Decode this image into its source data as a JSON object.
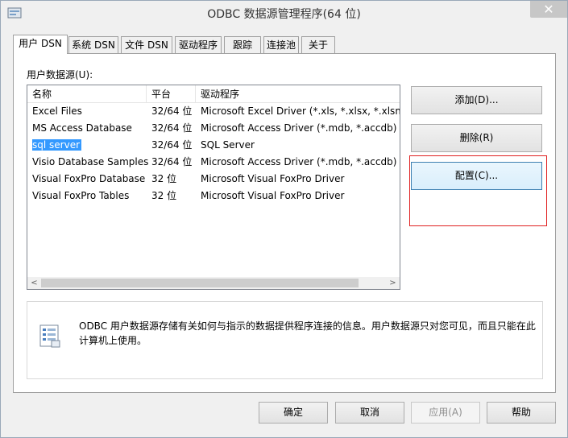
{
  "window": {
    "title": "ODBC 数据源管理程序(64 位)",
    "close_glyph": "✕"
  },
  "tabs": [
    {
      "label": "用户 DSN",
      "active": true
    },
    {
      "label": "系统 DSN"
    },
    {
      "label": "文件 DSN"
    },
    {
      "label": "驱动程序"
    },
    {
      "label": "跟踪"
    },
    {
      "label": "连接池"
    },
    {
      "label": "关于"
    }
  ],
  "panel": {
    "section_label": "用户数据源(U):",
    "columns": [
      "名称",
      "平台",
      "驱动程序"
    ],
    "rows": [
      {
        "name": "Excel Files",
        "platform": "32/64 位",
        "driver": "Microsoft Excel Driver (*.xls, *.xlsx, *.xlsm, *"
      },
      {
        "name": "MS Access Database",
        "platform": "32/64 位",
        "driver": "Microsoft Access Driver (*.mdb, *.accdb)"
      },
      {
        "name": "sql server",
        "platform": "32/64 位",
        "driver": "SQL Server",
        "selected": true
      },
      {
        "name": "Visio Database Samples",
        "platform": "32/64 位",
        "driver": "Microsoft Access Driver (*.mdb, *.accdb)"
      },
      {
        "name": "Visual FoxPro Database",
        "platform": "32 位",
        "driver": "Microsoft Visual FoxPro Driver"
      },
      {
        "name": "Visual FoxPro Tables",
        "platform": "32 位",
        "driver": "Microsoft Visual FoxPro Driver"
      }
    ],
    "scroll_left": "<",
    "scroll_right": ">",
    "buttons": {
      "add": "添加(D)...",
      "remove": "删除(R)",
      "configure": "配置(C)..."
    },
    "info_text": "ODBC 用户数据源存储有关如何与指示的数据提供程序连接的信息。用户数据源只对您可见，而且只能在此计算机上使用。"
  },
  "footer": {
    "ok": "确定",
    "cancel": "取消",
    "apply": "应用(A)",
    "help": "帮助"
  },
  "colors": {
    "selection": "#3399ff",
    "highlight_border": "#e02020"
  },
  "icons": {
    "app": "odbc-app-icon",
    "info": "data-sources-icon"
  }
}
